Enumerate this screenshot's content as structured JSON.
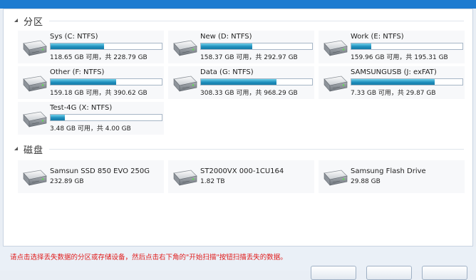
{
  "partitions_section": {
    "title": "分区"
  },
  "partitions": [
    {
      "name": "Sys (C: NTFS)",
      "info": "118.65 GB 可用，共 228.79 GB",
      "used_fraction": 0.48
    },
    {
      "name": "New (D: NTFS)",
      "info": "158.37 GB 可用，共 292.97 GB",
      "used_fraction": 0.46
    },
    {
      "name": "Work (E: NTFS)",
      "info": "159.96 GB 可用，共 195.31 GB",
      "used_fraction": 0.18
    },
    {
      "name": "Other (F: NTFS)",
      "info": "159.18 GB 可用，共 390.62 GB",
      "used_fraction": 0.59
    },
    {
      "name": "Data (G: NTFS)",
      "info": "308.33 GB 可用，共 968.29 GB",
      "used_fraction": 0.68
    },
    {
      "name": "SAMSUNGUSB (J: exFAT)",
      "info": "7.33 GB 可用，共 29.87 GB",
      "used_fraction": 0.75
    },
    {
      "name": "Test-4G (X: NTFS)",
      "info": "3.48 GB 可用，共 4.00 GB",
      "used_fraction": 0.13
    }
  ],
  "disks_section": {
    "title": "磁盘"
  },
  "disks": [
    {
      "name": "Samsun SSD 850 EVO 250G",
      "size": "232.89 GB"
    },
    {
      "name": "ST2000VX 000-1CU164",
      "size": "1.82 TB"
    },
    {
      "name": "Samsung Flash Drive",
      "size": "29.88 GB"
    }
  ],
  "hint_text": "请点击选择丢失数据的分区或存储设备，然后点击右下角的\"开始扫描\"按钮扫描丢失的数据。",
  "colors": {
    "title_bar": "#1e7bd0",
    "bar_fill": "#1f8fbd",
    "hint": "#e01b1b"
  }
}
